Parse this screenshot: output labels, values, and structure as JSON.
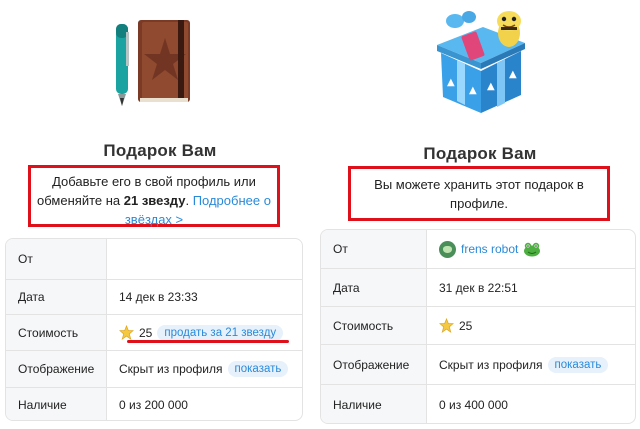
{
  "left": {
    "title": "Подарок Вам",
    "desc_part1": "Добавьте его в свой профиль или обменяйте на ",
    "desc_bold": "21 звезду",
    "desc_part2": ". ",
    "desc_link": "Подробнее о звёздах >",
    "rows": [
      {
        "label": "От",
        "value": ""
      },
      {
        "label": "Дата",
        "value": "14 дек в 23:33"
      },
      {
        "label": "Стоимость",
        "value": "25",
        "action": "продать за 21 звезду"
      },
      {
        "label": "Отображение",
        "value": "Скрыт из профиля",
        "action": "показать"
      },
      {
        "label": "Наличие",
        "value": "0 из 200 000"
      }
    ]
  },
  "right": {
    "title": "Подарок Вам",
    "desc": "Вы можете хранить этот подарок в профиле.",
    "rows": [
      {
        "label": "От",
        "value": "frens robot"
      },
      {
        "label": "Дата",
        "value": "31 дек в 22:51"
      },
      {
        "label": "Стоимость",
        "value": "25"
      },
      {
        "label": "Отображение",
        "value": "Скрыт из профиля",
        "action": "показать"
      },
      {
        "label": "Наличие",
        "value": "0 из 400 000"
      }
    ]
  },
  "icons": {
    "left_gift": "notebook-with-pen-icon",
    "right_gift": "gift-box-with-snake-icon",
    "star": "star-icon",
    "avatar": "frog-avatar-icon",
    "emoji": "frog-emoji-icon"
  },
  "colors": {
    "highlight": "#e0101a",
    "link": "#2a8ad8",
    "pill_bg": "#e7f1fb"
  }
}
